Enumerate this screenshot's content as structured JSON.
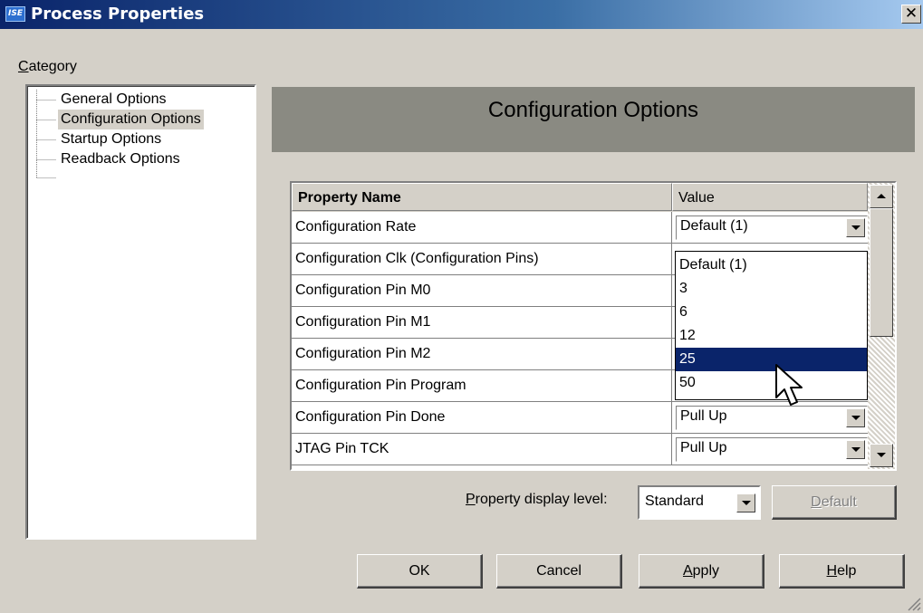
{
  "window": {
    "title": "Process Properties",
    "icon_label": "ISE",
    "close_glyph": "✕"
  },
  "category": {
    "label_accel": "C",
    "label_rest": "ategory",
    "items": [
      {
        "label": "General Options",
        "selected": false
      },
      {
        "label": "Configuration Options",
        "selected": true
      },
      {
        "label": "Startup Options",
        "selected": false
      },
      {
        "label": "Readback Options",
        "selected": false
      }
    ]
  },
  "header": {
    "title": "Configuration Options"
  },
  "grid": {
    "col_name": "Property Name",
    "col_value": "Value",
    "rows": [
      {
        "name": "Configuration Rate",
        "value": "Default (1)"
      },
      {
        "name": "Configuration Clk (Configuration Pins)",
        "value": ""
      },
      {
        "name": "Configuration Pin M0",
        "value": ""
      },
      {
        "name": "Configuration Pin M1",
        "value": ""
      },
      {
        "name": "Configuration Pin M2",
        "value": ""
      },
      {
        "name": "Configuration Pin Program",
        "value": ""
      },
      {
        "name": "Configuration Pin Done",
        "value": "Pull Up"
      },
      {
        "name": "JTAG Pin TCK",
        "value": "Pull Up"
      }
    ]
  },
  "dropdown": {
    "options": [
      "Default (1)",
      "3",
      "6",
      "12",
      "25",
      "50"
    ],
    "highlighted": "25"
  },
  "display_level": {
    "label_accel": "P",
    "label_rest": "roperty display level:",
    "value": "Standard"
  },
  "buttons": {
    "default": {
      "accel": "D",
      "rest": "efault"
    },
    "ok": "OK",
    "cancel": "Cancel",
    "apply": {
      "accel": "A",
      "rest": "pply"
    },
    "help": {
      "accel": "H",
      "rest": "elp"
    }
  },
  "colors": {
    "title_bar": "#0a246a",
    "face": "#d4d0c8",
    "banner": "#8a8a82",
    "selection": "#0a246a"
  }
}
